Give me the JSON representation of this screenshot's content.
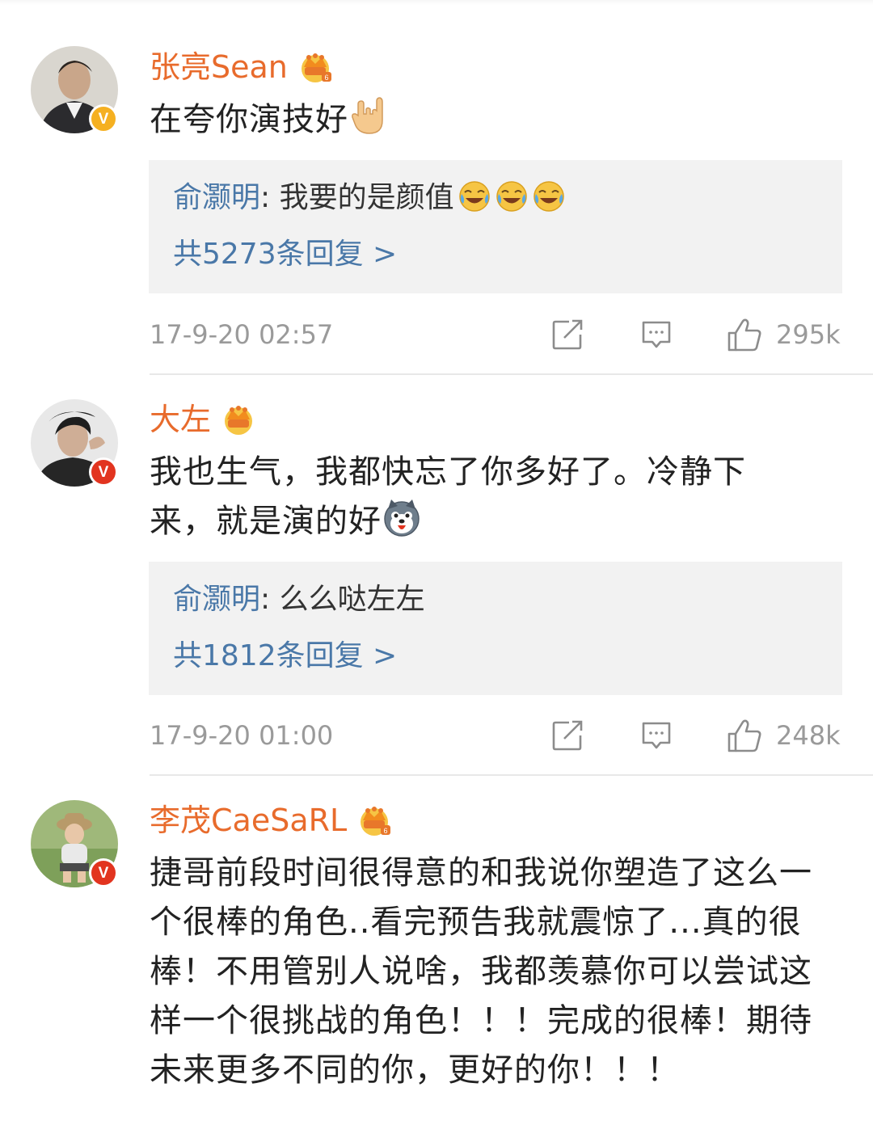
{
  "comments": [
    {
      "username": "张亮Sean",
      "verified": "gold",
      "text": "在夸你演技好",
      "text_emoji": "rock-hand-emoji",
      "reply": {
        "author": "俞灏明",
        "separator": ": ",
        "text": "我要的是颜值",
        "emoji": "laughing-tears-emoji",
        "emoji_count": 3,
        "count_label": "共5273条回复 >"
      },
      "timestamp": "17-9-20 02:57",
      "likes": "295k"
    },
    {
      "username": "大左",
      "verified": "red",
      "text": "我也生气，我都快忘了你多好了。冷静下来，就是演的好",
      "text_emoji": "husky-emoji",
      "reply": {
        "author": "俞灏明",
        "separator": ": ",
        "text": "么么哒左左",
        "count_label": "共1812条回复 >"
      },
      "timestamp": "17-9-20 01:00",
      "likes": "248k"
    },
    {
      "username": "李茂CaeSaRL",
      "verified": "red",
      "text": "捷哥前段时间很得意的和我说你塑造了这么一个很棒的角色..看完预告我就震惊了...真的很棒！不用管别人说啥，我都羡慕你可以尝试这样一个很挑战的角色！！！完成的很棒！期待未来更多不同的你，更好的你！！！"
    }
  ],
  "badge_letter": "V",
  "colors": {
    "username": "#e86b2c",
    "reply_link": "#4a78a8",
    "meta": "#9a9a9a",
    "reply_bg": "#f2f2f2",
    "badge_gold": "#f5b021",
    "badge_red": "#e2341f"
  }
}
